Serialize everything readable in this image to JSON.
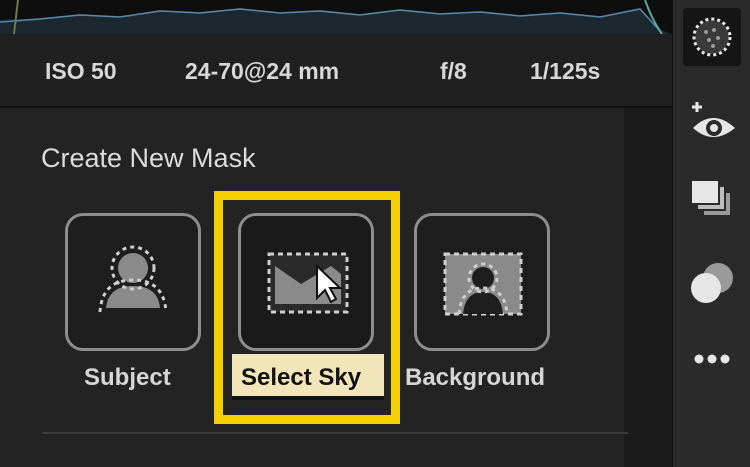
{
  "photo_info": {
    "iso": "ISO 50",
    "lens": "24-70@24 mm",
    "aperture": "f/8",
    "shutter": "1/125s"
  },
  "create_mask": {
    "title": "Create New Mask",
    "options": [
      {
        "label": "Subject",
        "icon": "subject-mask-icon"
      },
      {
        "label": "Select Sky",
        "icon": "sky-mask-icon"
      },
      {
        "label": "Background",
        "icon": "background-mask-icon"
      }
    ]
  },
  "colors": {
    "highlight": "#f4d000",
    "panel": "#232323",
    "toolbar": "#2a2a2a"
  },
  "toolbar": {
    "tools": [
      "masking-icon",
      "add-eye-icon",
      "layers-icon",
      "blend-icon",
      "more-icon"
    ]
  }
}
